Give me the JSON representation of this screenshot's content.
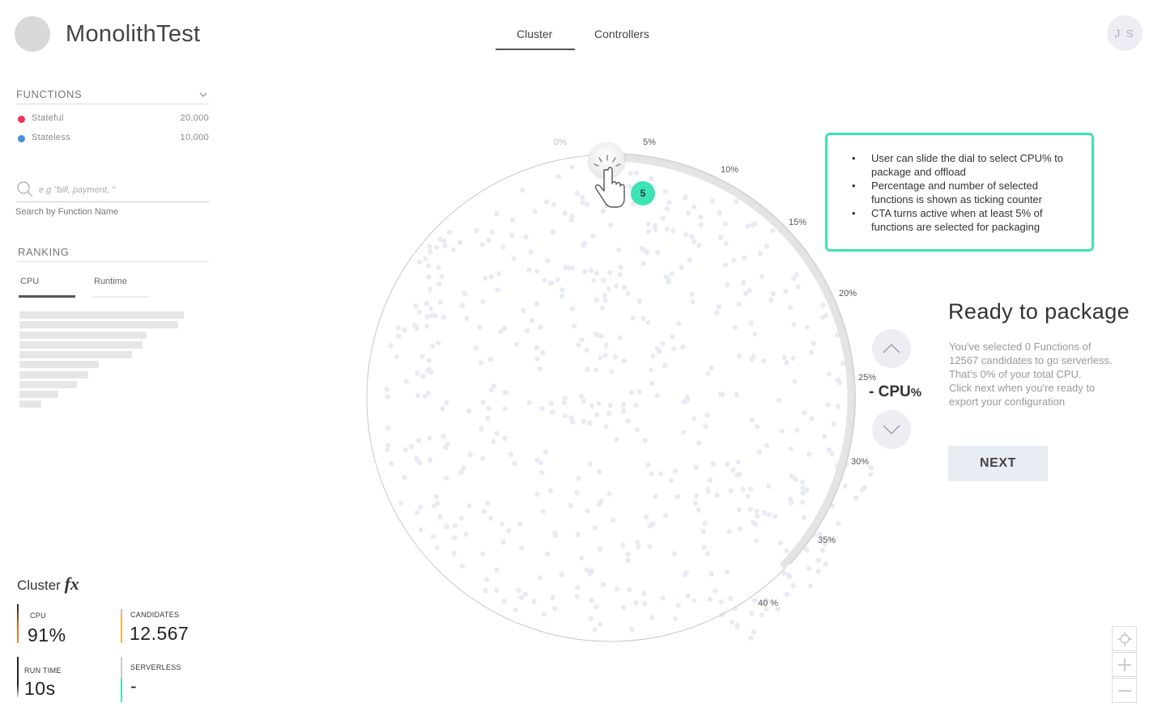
{
  "header": {
    "title": "MonolithTest",
    "tabs": [
      {
        "label": "Cluster",
        "active": true
      },
      {
        "label": "Controllers",
        "active": false
      }
    ],
    "avatar_initials": "J S"
  },
  "sidebar": {
    "functions_title": "FUNCTIONS",
    "functions": [
      {
        "name": "Stateful",
        "count": "20,000",
        "color": "#f0325a"
      },
      {
        "name": "Stateless",
        "count": "10,000",
        "color": "#4a8fe0"
      }
    ],
    "search": {
      "placeholder": "e.g \"bill, payment, \"",
      "help": "Search by Function Name"
    },
    "ranking": {
      "title": "RANKING",
      "tabs": [
        {
          "label": "CPU",
          "active": true
        },
        {
          "label": "Runtime",
          "active": false
        }
      ]
    }
  },
  "cluster_fx": {
    "title": "Cluster",
    "fx_symbol": "fx",
    "metrics": [
      {
        "label": "CPU",
        "value": "91%"
      },
      {
        "label": "CANDIDATES",
        "value": "12.567"
      },
      {
        "label": "RUN TIME",
        "value": "10s"
      },
      {
        "label": "SERVERLESS",
        "value": "-"
      }
    ]
  },
  "dial": {
    "ticks": [
      "0%",
      "5%",
      "10%",
      "15%",
      "20%",
      "25%",
      "30%",
      "35%",
      "40 %"
    ],
    "counter": "5",
    "cpu_value": "- CPU",
    "cpu_unit": "%"
  },
  "tooltip": {
    "items": [
      "User can slide the dial to select CPU% to package and offload",
      "Percentage and number of selected functions is shown as ticking counter",
      "CTA turns active when at least 5% of functions are selected for packaging"
    ],
    "border_color": "#3ee3b4"
  },
  "package": {
    "title": "Ready to package",
    "lines": [
      "You've selected 0 Functions of",
      "12567 candidates to go serverless.",
      "That's 0% of your total CPU.",
      "Click next when you're ready to",
      "export your configuration"
    ],
    "next_label": "NEXT"
  },
  "icons": {
    "collapse": "chevron-down-icon",
    "search": "search-icon",
    "dial_up": "chevron-up-icon",
    "dial_down": "chevron-down-icon",
    "locate": "crosshair-icon",
    "zoom_in": "plus-icon",
    "zoom_out": "minus-icon",
    "cursor": "hand-pointer-icon"
  }
}
